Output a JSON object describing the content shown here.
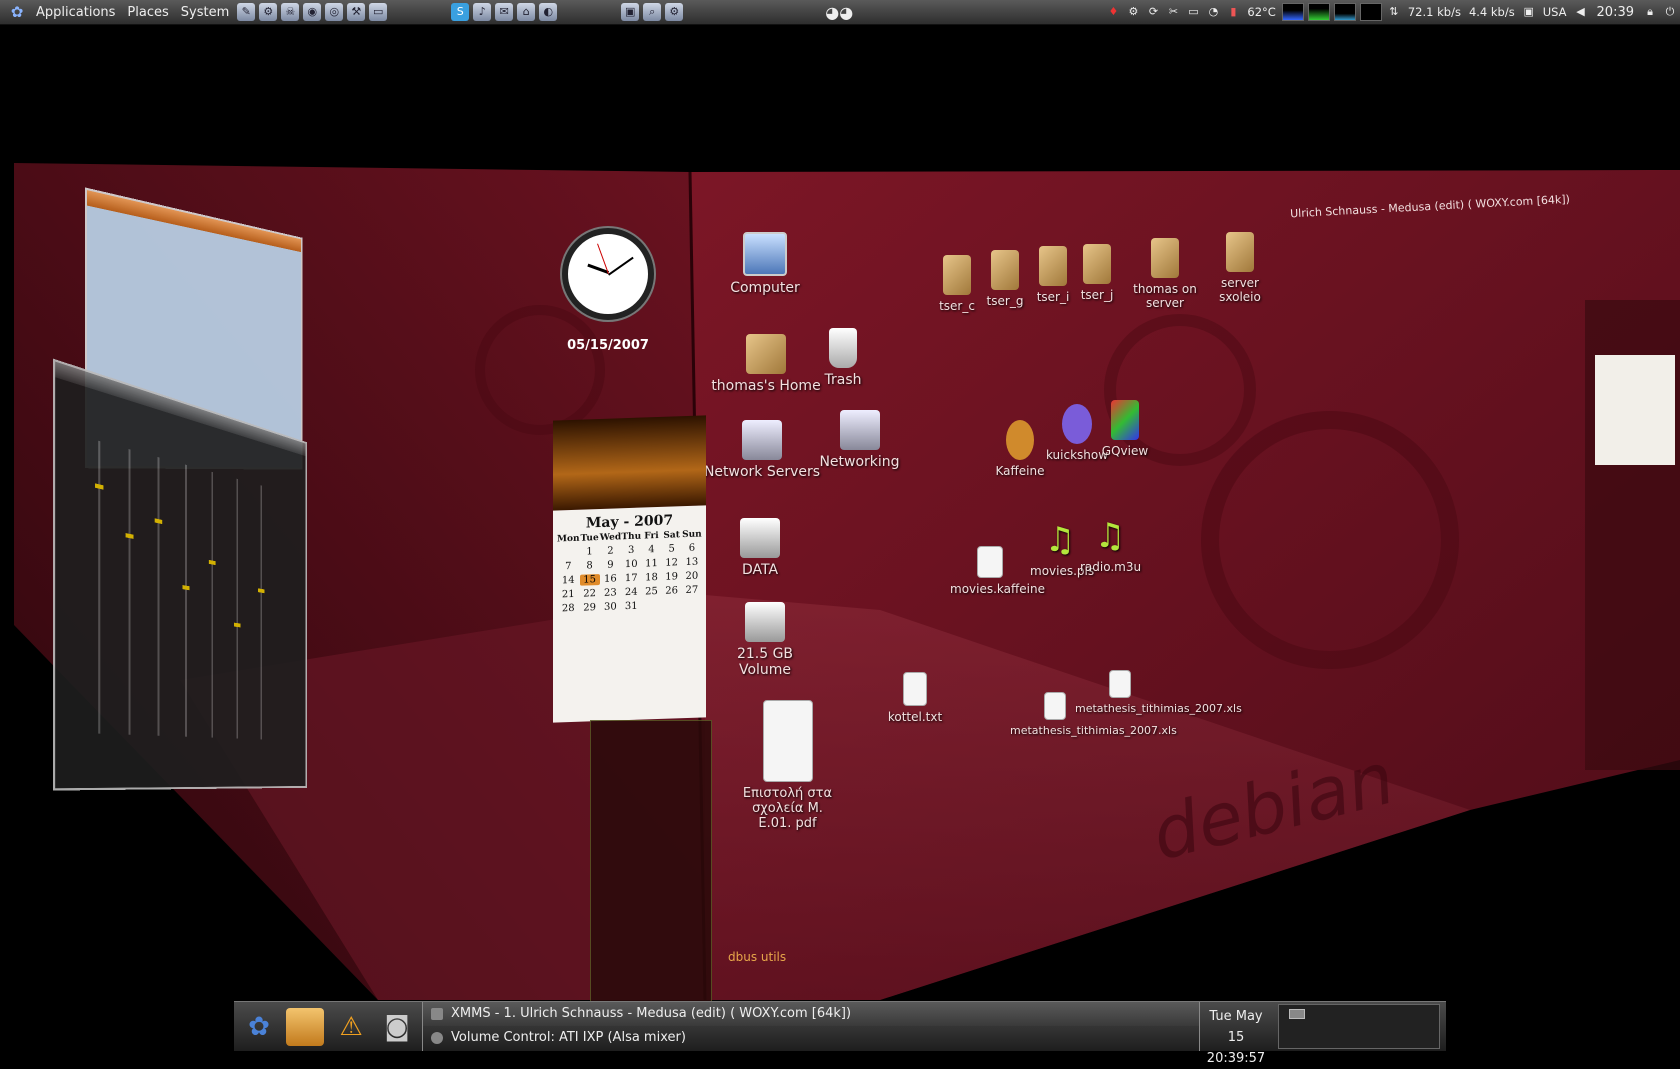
{
  "top_panel": {
    "menus": [
      "Applications",
      "Places",
      "System"
    ],
    "temperature": "62°C",
    "net_down": "72.1 kb/s",
    "net_up": "4.4 kb/s",
    "keyboard_layout": "USA",
    "time": "20:39"
  },
  "right_face": {
    "window_title": "Ulrich Schnauss - Medusa (edit) ( WOXY.com [64k])",
    "icons": [
      "tser_c",
      "tser_g",
      "tser_i",
      "tser_j",
      "thomas on server",
      "server sxoleio",
      "Kaffeine",
      "kuickshow",
      "GQview",
      "movies.kaffeine",
      "movies.pls",
      "radio.m3u",
      "kottel.txt",
      "metathesis_tithimias_2007.xls",
      "metathesis_tithimias_2007.xls"
    ]
  },
  "front_face": {
    "icons": [
      "Computer",
      "Trash",
      "thomas's Home",
      "Network Servers",
      "Networking",
      "DATA",
      "21.5 GB Volume",
      "Επιστολή στα σχολεία Μ. Ε.01. pdf"
    ],
    "watermark": "debian",
    "dbus_label": "dbus utils"
  },
  "clock_desklet": {
    "date": "05/15/2007"
  },
  "calendar_desklet": {
    "title": "May - 2007",
    "weekdays": [
      "Mon",
      "Tue",
      "Wed",
      "Thu",
      "Fri",
      "Sat",
      "Sun"
    ],
    "days": [
      "",
      "1",
      "2",
      "3",
      "4",
      "5",
      "6",
      "7",
      "8",
      "9",
      "10",
      "11",
      "12",
      "13",
      "14",
      "15",
      "16",
      "17",
      "18",
      "19",
      "20",
      "21",
      "22",
      "23",
      "24",
      "25",
      "26",
      "27",
      "28",
      "29",
      "30",
      "31",
      "",
      "",
      ""
    ],
    "today": "15"
  },
  "bottom_panel": {
    "tasks": [
      "XMMS - 1. Ulrich Schnauss - Medusa (edit) ( WOXY.com [64k])",
      "Volume Control: ATI IXP (Alsa mixer)"
    ],
    "clock_day": "Tue May 15",
    "clock_time": "20:39:57"
  }
}
